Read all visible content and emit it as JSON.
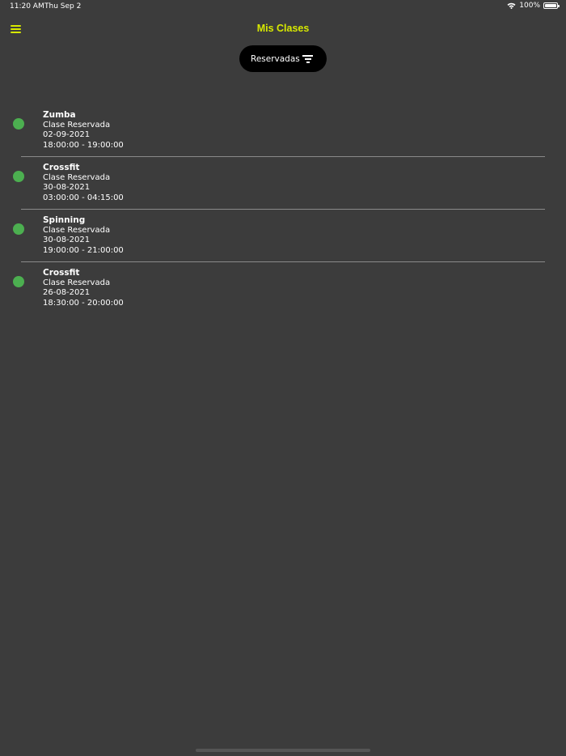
{
  "status_bar": {
    "time": "11:20 AM",
    "date": "Thu Sep 2",
    "battery": "100%",
    "battery_level": 1.0
  },
  "header": {
    "title": "Mis Clases",
    "menu_icon": "hamburger-menu-icon",
    "accent_color": "#d7e800"
  },
  "filter": {
    "label": "Reservadas",
    "icon": "filter-icon"
  },
  "classes": [
    {
      "name": "Zumba",
      "status": "Clase Reservada",
      "date": "02-09-2021",
      "time": "18:00:00 - 19:00:00",
      "status_color": "#4caf50"
    },
    {
      "name": "Crossfit",
      "status": "Clase Reservada",
      "date": "30-08-2021",
      "time": "03:00:00 - 04:15:00",
      "status_color": "#4caf50"
    },
    {
      "name": "Spinning",
      "status": "Clase Reservada",
      "date": "30-08-2021",
      "time": "19:00:00 - 21:00:00",
      "status_color": "#4caf50"
    },
    {
      "name": "Crossfit",
      "status": "Clase Reservada",
      "date": "26-08-2021",
      "time": "18:30:00 - 20:00:00",
      "status_color": "#4caf50"
    }
  ]
}
